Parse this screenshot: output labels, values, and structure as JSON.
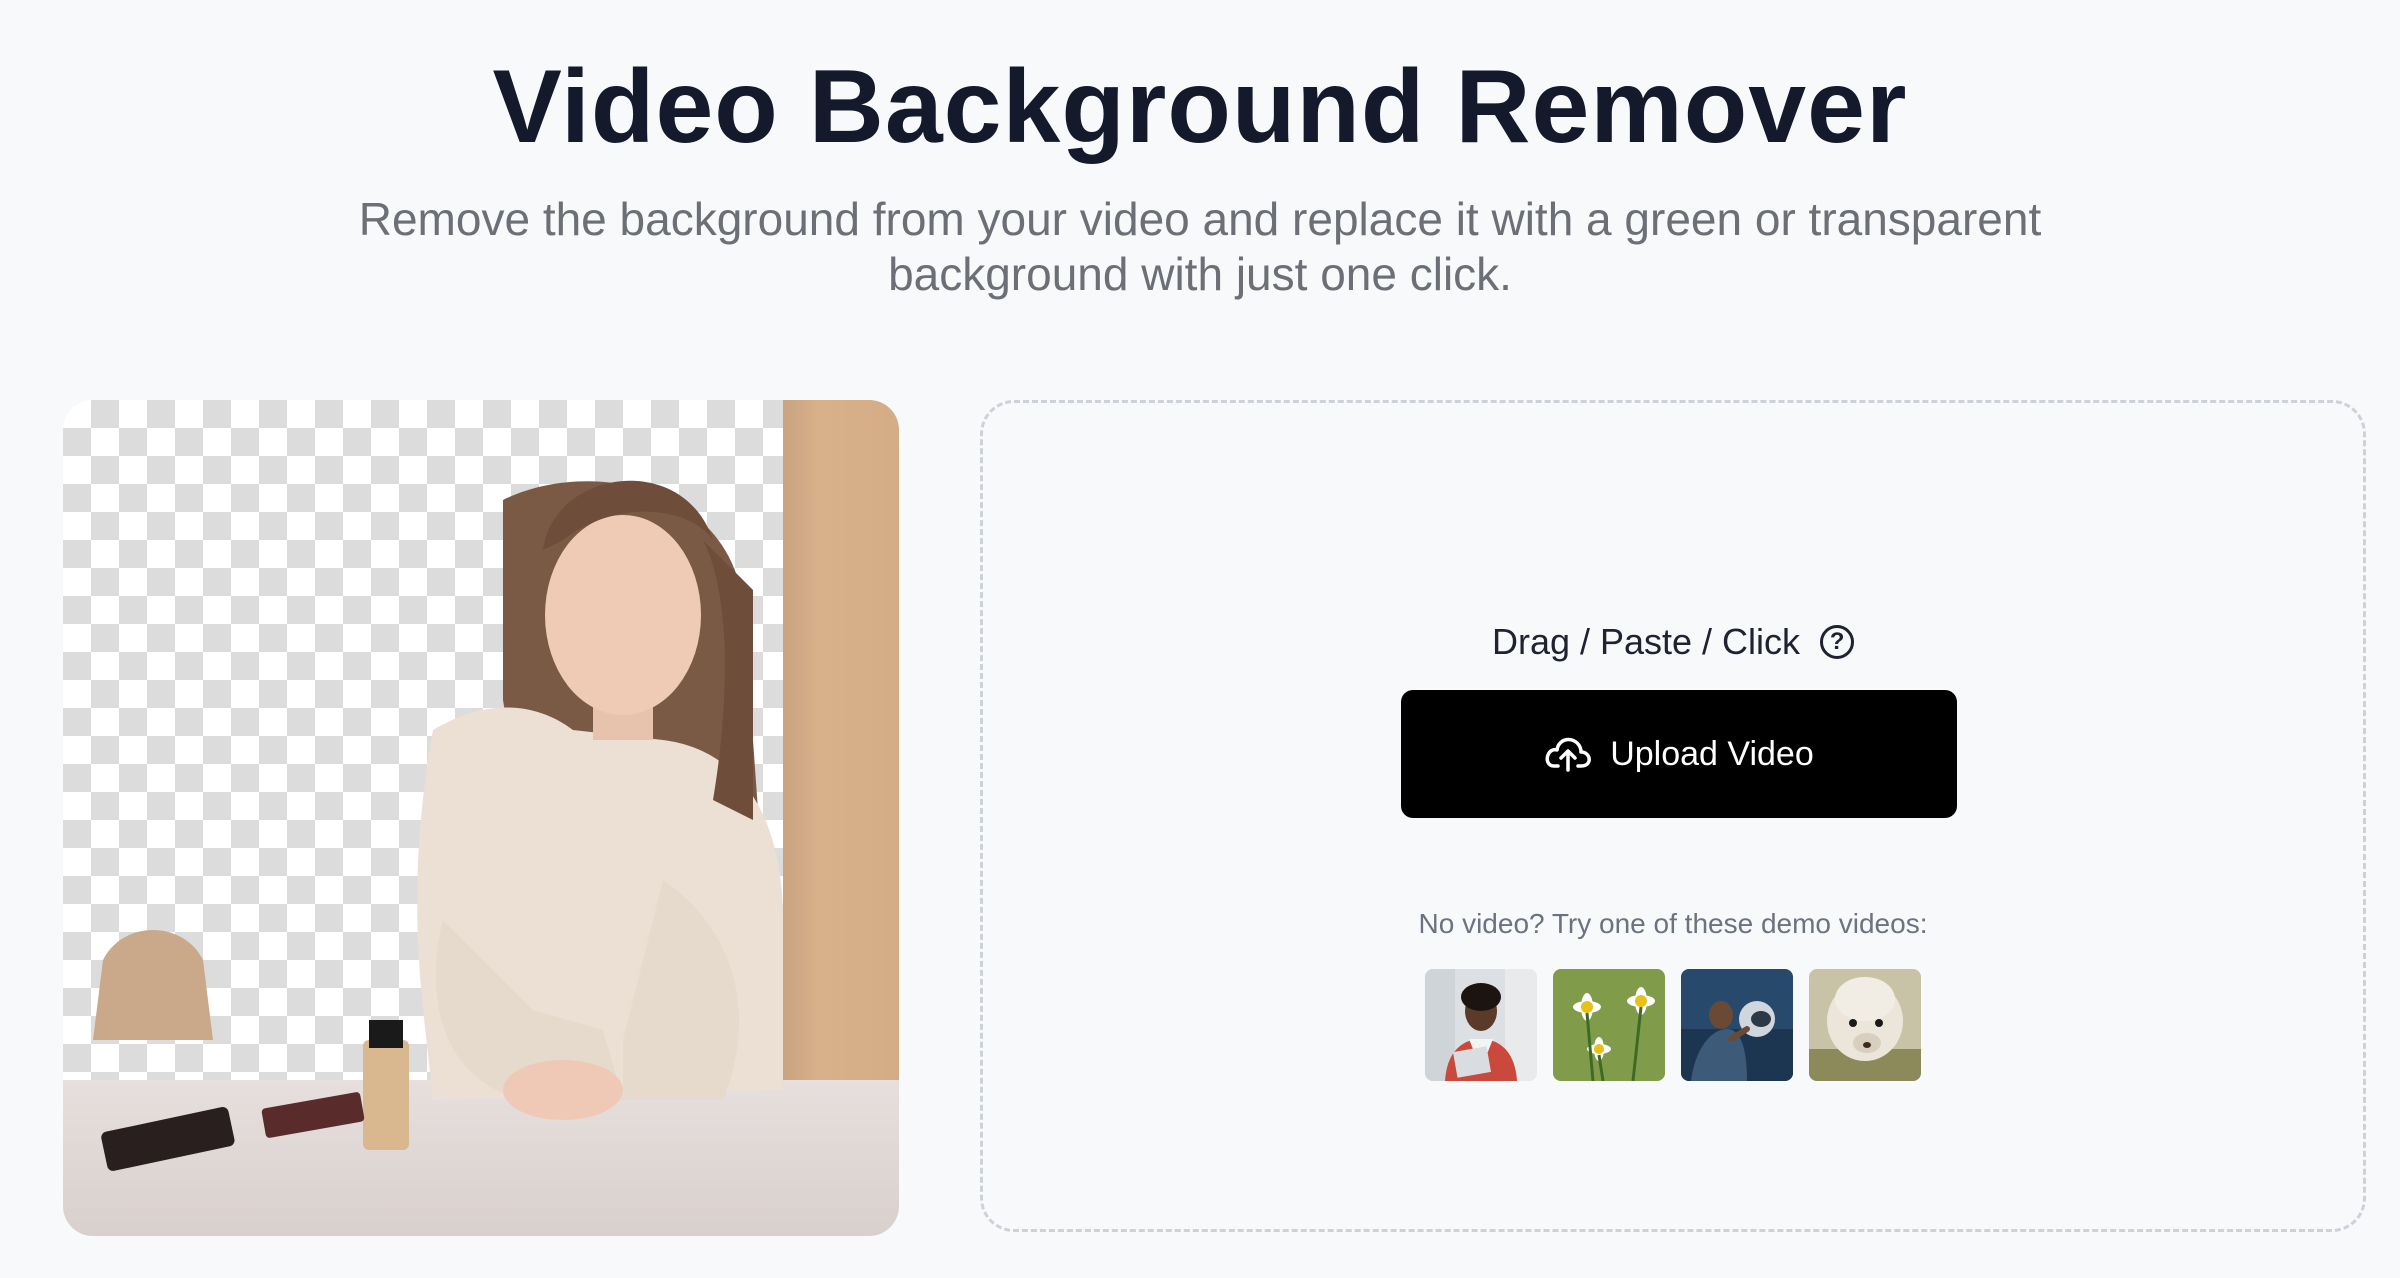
{
  "header": {
    "title": "Video Background Remover",
    "subtitle": "Remove the background from your video and replace it with a green or transparent background with just one click."
  },
  "upload": {
    "hint": "Drag / Paste / Click",
    "help_icon": "question-circle-icon",
    "button_label": "Upload Video",
    "button_icon": "cloud-upload-icon",
    "demo_text": "No video? Try one of these demo videos:"
  },
  "demos": [
    {
      "name": "woman-with-laptop"
    },
    {
      "name": "daisy-flowers"
    },
    {
      "name": "person-with-helmet"
    },
    {
      "name": "alpaca"
    }
  ],
  "colors": {
    "title": "#141a2b",
    "button_bg": "#000000",
    "dashed_border": "#cdd1d8"
  }
}
